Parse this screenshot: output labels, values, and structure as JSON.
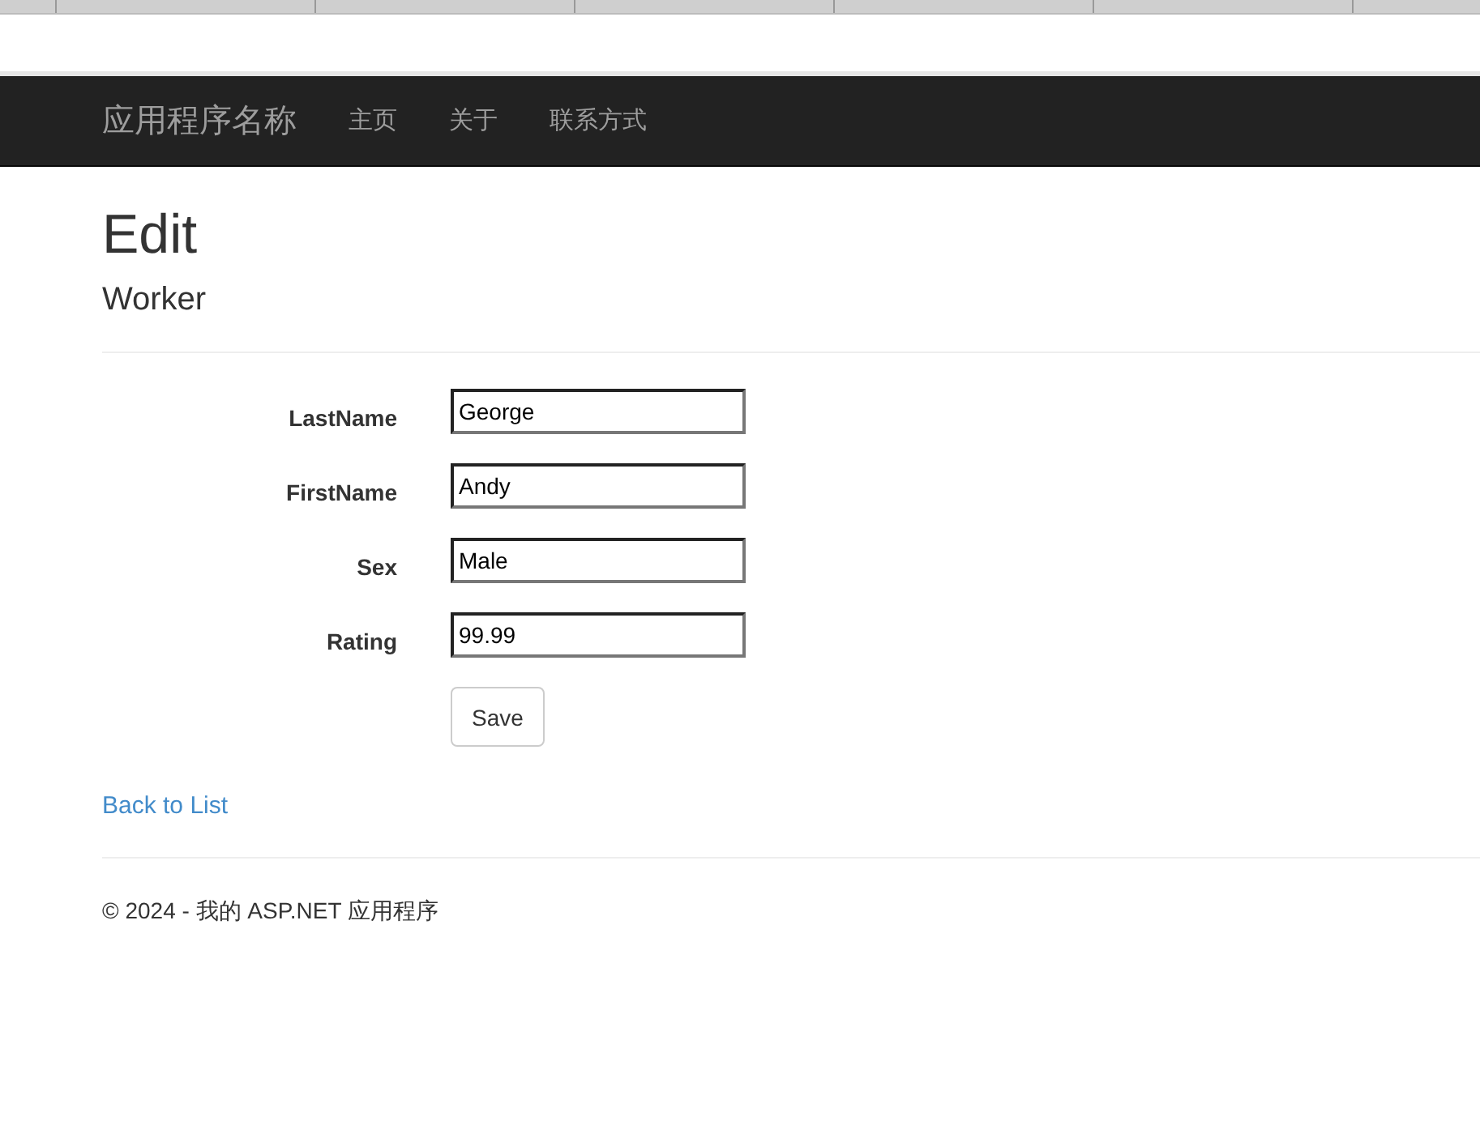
{
  "navbar": {
    "brand": "应用程序名称",
    "links": [
      "主页",
      "关于",
      "联系方式"
    ]
  },
  "heading": {
    "title": "Edit",
    "subtitle": "Worker"
  },
  "form": {
    "fields": [
      {
        "label": "LastName",
        "value": "George"
      },
      {
        "label": "FirstName",
        "value": "Andy"
      },
      {
        "label": "Sex",
        "value": "Male"
      },
      {
        "label": "Rating",
        "value": "99.99"
      }
    ],
    "submit": "Save"
  },
  "back_link": "Back to List",
  "footer": "© 2024 - 我的 ASP.NET 应用程序"
}
